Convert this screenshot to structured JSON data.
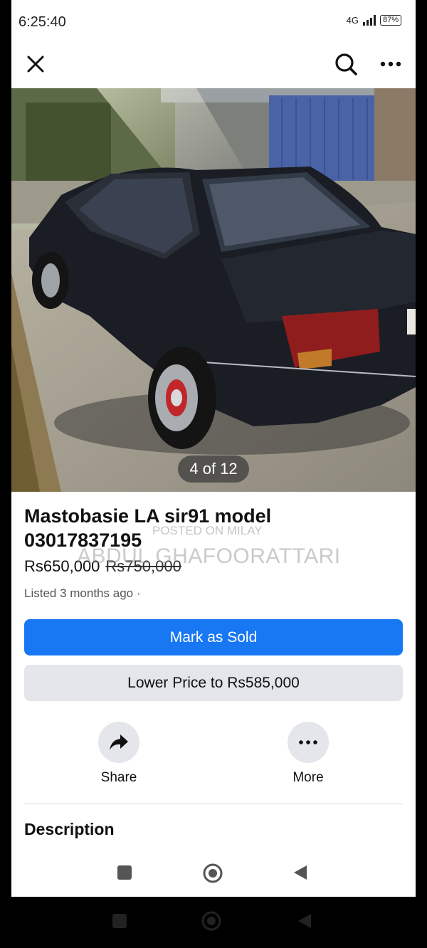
{
  "status_bar": {
    "time": "6:25:40",
    "network": "4G",
    "battery": "87%"
  },
  "photo": {
    "counter": "4 of 12"
  },
  "listing": {
    "title": "Mastobasie LA sir91 model 03017837195",
    "price": "Rs650,000",
    "original_price": "Rs750,000",
    "listed": "Listed 3 months ago ·"
  },
  "watermark": {
    "line1": "POSTED ON MILAY",
    "line2": "ABDUL GHAFOORATTARI"
  },
  "buttons": {
    "mark_sold": "Mark as Sold",
    "lower_price": "Lower Price to Rs585,000"
  },
  "actions": {
    "share": "Share",
    "more": "More"
  },
  "section": {
    "description": "Description"
  },
  "icons": [
    "close-icon",
    "search-icon",
    "more-options-icon",
    "share-icon",
    "more-icon",
    "recents-icon",
    "home-icon",
    "back-icon"
  ],
  "colors": {
    "primary": "#1877f2",
    "secondary_bg": "#e4e6eb"
  }
}
